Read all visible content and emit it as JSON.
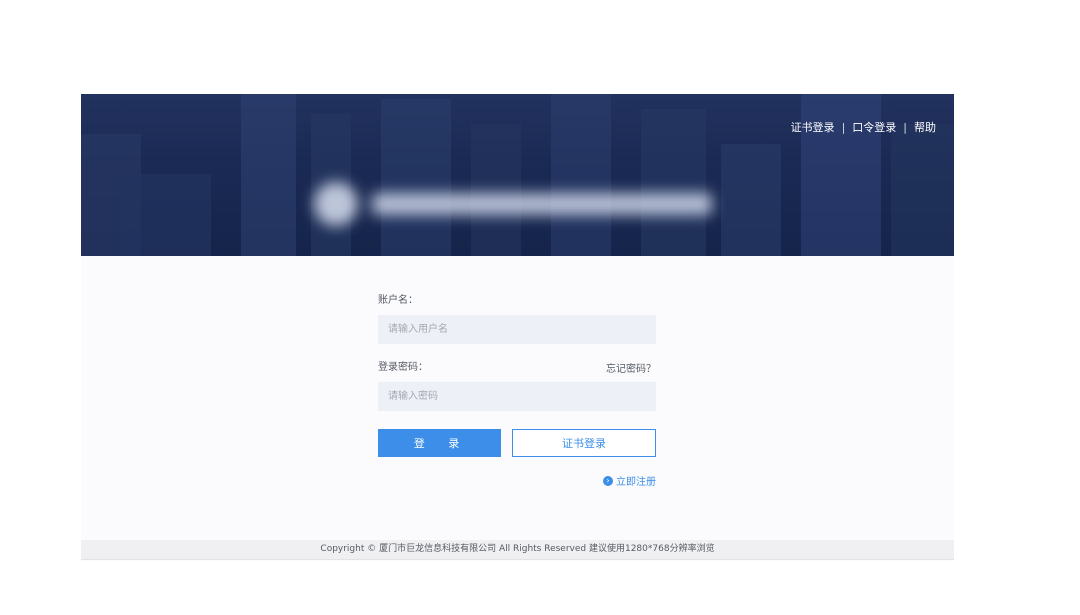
{
  "header": {
    "links": [
      "证书登录",
      "口令登录",
      "帮助"
    ],
    "separator": "|"
  },
  "form": {
    "username_label": "账户名：",
    "username_placeholder": "请输入用户名",
    "password_label": "登录密码：",
    "forgot_label": "忘记密码？",
    "password_placeholder": "请输入密码",
    "login_button": "登 录",
    "cert_button": "证书登录",
    "register_link": "立即注册"
  },
  "footer": {
    "text": "Copyright © 厦门市巨龙信息科技有限公司 All Rights Reserved 建议使用1280*768分辨率浏览"
  },
  "colors": {
    "banner": "#1b2a55",
    "accent": "#3c8ee8",
    "input_bg": "#eef0f7"
  }
}
